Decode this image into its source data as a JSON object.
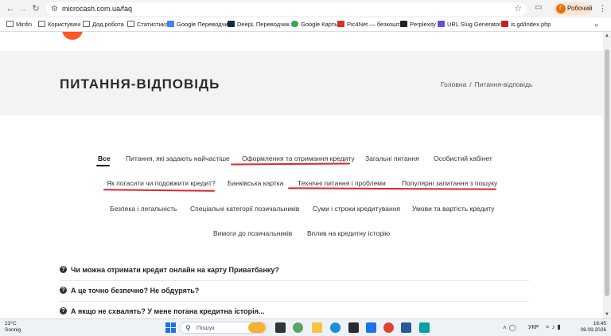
{
  "browser": {
    "url": "microcash.com.ua/faq",
    "profile_label": "Робочий",
    "profile_initial": "Г",
    "bookmarks": [
      "Minfin",
      "Користувачі",
      "Дод.робота",
      "Статистика",
      "Google Переводчик",
      "DeepL Переводчик...",
      "Google Карты",
      "Pic4Net — безкошт...",
      "Perplexity",
      "URL Slug Generator...",
      "is.gd/index.php"
    ],
    "bookmarks_more": "»"
  },
  "hero": {
    "title": "ПИТАННЯ-ВІДПОВІДЬ",
    "breadcrumb_home": "Головна",
    "breadcrumb_sep": "/",
    "breadcrumb_current": "Питання-відповідь"
  },
  "filters": [
    "Все",
    "Питання, які задають найчастіше",
    "Оформлення та отримання кредиту",
    "Загальні питання",
    "Особистий кабінет",
    "Як погасити чи подовжити кредит?",
    "Банківська картка",
    "Технічні питання і проблеми",
    "Популярні запитання з пошуку",
    "Безпека і легальність",
    "Спеціальні категорії позичальників",
    "Суми і строки кредитування",
    "Умови та вартість кредиту",
    "Вимоги до позичальників",
    "Вплив на кредитну історію"
  ],
  "faq": [
    "Чи можна отримати кредит онлайн на карту Приватбанку?",
    "А це точно безпечно? Не обдурять?",
    "А якщо не схвалять? У мене погана кредитна історія..."
  ],
  "faq_icon": "?",
  "taskbar": {
    "temp": "23°C",
    "condition": "Sonnig",
    "search_placeholder": "Пошук",
    "lang": "УКР",
    "time": "16:45",
    "date": "08.09.2026"
  },
  "colors": {
    "accent_underline": "#e0262d",
    "logo": "#ff5722",
    "hero_bg": "#f3f3f3"
  }
}
